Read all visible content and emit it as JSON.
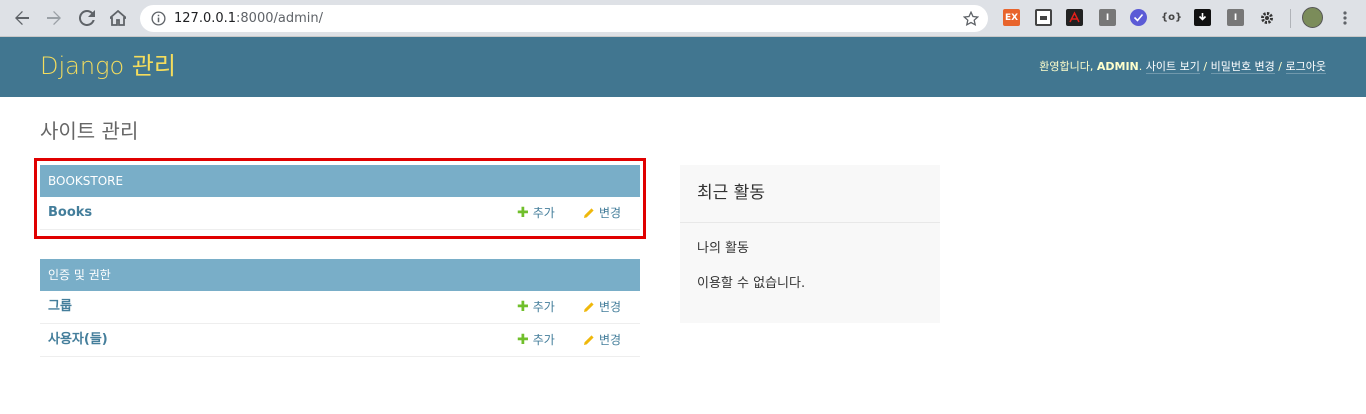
{
  "browser": {
    "url_host": "127.0.0.1",
    "url_rest": ":8000/admin/",
    "extensions": [
      "ex-extension-icon",
      "screen-extension-icon",
      "pdf-extension-icon",
      "tab-extension-icon",
      "check-extension-icon",
      "bracket-extension-icon",
      "download-extension-icon",
      "tab2-extension-icon",
      "gear-icon"
    ]
  },
  "header": {
    "branding": "Django 관리",
    "welcome": "환영합니다,",
    "username": "ADMIN",
    "view_site": "사이트 보기",
    "change_password": "비밀번호 변경",
    "logout": "로그아웃",
    "separator": "/"
  },
  "page": {
    "title": "사이트 관리"
  },
  "apps": [
    {
      "caption": "BOOKSTORE",
      "models": [
        {
          "name": "Books",
          "add": "추가",
          "change": "변경"
        }
      ]
    },
    {
      "caption": "인증 및 권한",
      "models": [
        {
          "name": "그룹",
          "add": "추가",
          "change": "변경"
        },
        {
          "name": "사용자(들)",
          "add": "추가",
          "change": "변경"
        }
      ]
    }
  ],
  "recent": {
    "title": "최근 활동",
    "subtitle": "나의 활동",
    "empty": "이용할 수 없습니다."
  },
  "colors": {
    "header_bg": "#417690",
    "branding": "#f5dd5d",
    "caption_bg": "#79aec8",
    "link": "#447e9b",
    "add_icon": "#70bf2b",
    "change_icon": "#efb80b",
    "highlight_border": "#e00000"
  }
}
